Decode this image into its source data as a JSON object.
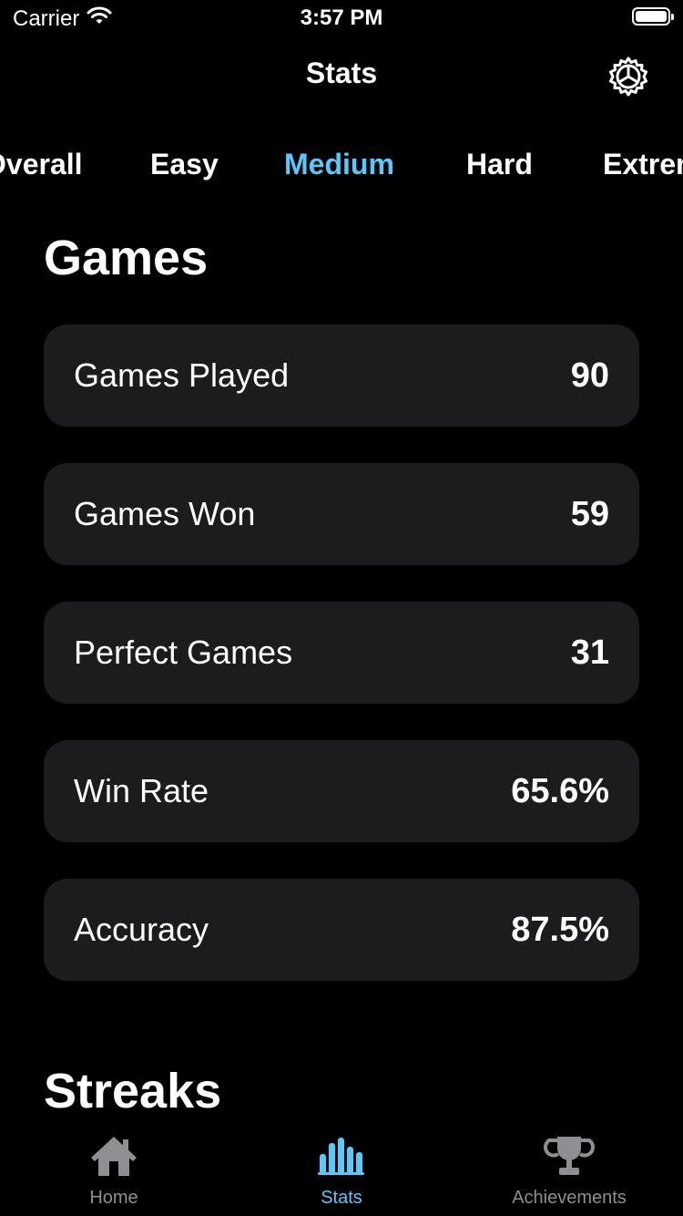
{
  "status_bar": {
    "carrier": "Carrier",
    "time": "3:57 PM",
    "battery_level": 1.0
  },
  "nav": {
    "title": "Stats",
    "settings_icon": "gear-icon"
  },
  "tabs": [
    {
      "label": "Overall",
      "active": false
    },
    {
      "label": "Easy",
      "active": false
    },
    {
      "label": "Medium",
      "active": true
    },
    {
      "label": "Hard",
      "active": false
    },
    {
      "label": "Extreme",
      "active": false
    }
  ],
  "sections": {
    "games_heading": "Games",
    "streaks_heading": "Streaks"
  },
  "stats": [
    {
      "label": "Games Played",
      "value": "90"
    },
    {
      "label": "Games Won",
      "value": "59"
    },
    {
      "label": "Perfect Games",
      "value": "31"
    },
    {
      "label": "Win Rate",
      "value": "65.6%"
    },
    {
      "label": "Accuracy",
      "value": "87.5%"
    }
  ],
  "tab_bar": {
    "items": [
      {
        "label": "Home",
        "icon": "house-icon",
        "active": false
      },
      {
        "label": "Stats",
        "icon": "bar-chart-icon",
        "active": true
      },
      {
        "label": "Achievements",
        "icon": "trophy-icon",
        "active": false
      }
    ]
  },
  "colors": {
    "accent": "#5ac8fa",
    "row_background": "#1c1c1e",
    "inactive": "#8e8e93"
  }
}
